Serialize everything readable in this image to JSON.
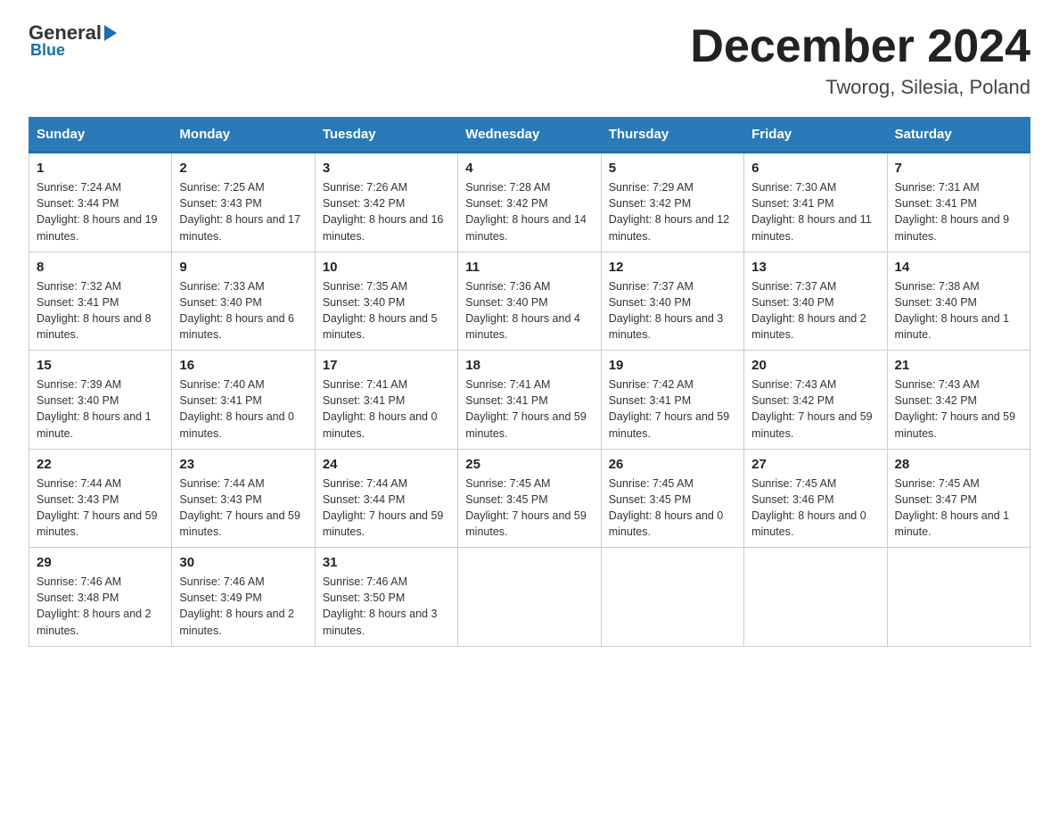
{
  "header": {
    "logo_general": "General",
    "logo_blue": "Blue",
    "month_title": "December 2024",
    "location": "Tworog, Silesia, Poland"
  },
  "days_of_week": [
    "Sunday",
    "Monday",
    "Tuesday",
    "Wednesday",
    "Thursday",
    "Friday",
    "Saturday"
  ],
  "weeks": [
    [
      {
        "day": "1",
        "sunrise": "7:24 AM",
        "sunset": "3:44 PM",
        "daylight": "8 hours and 19 minutes."
      },
      {
        "day": "2",
        "sunrise": "7:25 AM",
        "sunset": "3:43 PM",
        "daylight": "8 hours and 17 minutes."
      },
      {
        "day": "3",
        "sunrise": "7:26 AM",
        "sunset": "3:42 PM",
        "daylight": "8 hours and 16 minutes."
      },
      {
        "day": "4",
        "sunrise": "7:28 AM",
        "sunset": "3:42 PM",
        "daylight": "8 hours and 14 minutes."
      },
      {
        "day": "5",
        "sunrise": "7:29 AM",
        "sunset": "3:42 PM",
        "daylight": "8 hours and 12 minutes."
      },
      {
        "day": "6",
        "sunrise": "7:30 AM",
        "sunset": "3:41 PM",
        "daylight": "8 hours and 11 minutes."
      },
      {
        "day": "7",
        "sunrise": "7:31 AM",
        "sunset": "3:41 PM",
        "daylight": "8 hours and 9 minutes."
      }
    ],
    [
      {
        "day": "8",
        "sunrise": "7:32 AM",
        "sunset": "3:41 PM",
        "daylight": "8 hours and 8 minutes."
      },
      {
        "day": "9",
        "sunrise": "7:33 AM",
        "sunset": "3:40 PM",
        "daylight": "8 hours and 6 minutes."
      },
      {
        "day": "10",
        "sunrise": "7:35 AM",
        "sunset": "3:40 PM",
        "daylight": "8 hours and 5 minutes."
      },
      {
        "day": "11",
        "sunrise": "7:36 AM",
        "sunset": "3:40 PM",
        "daylight": "8 hours and 4 minutes."
      },
      {
        "day": "12",
        "sunrise": "7:37 AM",
        "sunset": "3:40 PM",
        "daylight": "8 hours and 3 minutes."
      },
      {
        "day": "13",
        "sunrise": "7:37 AM",
        "sunset": "3:40 PM",
        "daylight": "8 hours and 2 minutes."
      },
      {
        "day": "14",
        "sunrise": "7:38 AM",
        "sunset": "3:40 PM",
        "daylight": "8 hours and 1 minute."
      }
    ],
    [
      {
        "day": "15",
        "sunrise": "7:39 AM",
        "sunset": "3:40 PM",
        "daylight": "8 hours and 1 minute."
      },
      {
        "day": "16",
        "sunrise": "7:40 AM",
        "sunset": "3:41 PM",
        "daylight": "8 hours and 0 minutes."
      },
      {
        "day": "17",
        "sunrise": "7:41 AM",
        "sunset": "3:41 PM",
        "daylight": "8 hours and 0 minutes."
      },
      {
        "day": "18",
        "sunrise": "7:41 AM",
        "sunset": "3:41 PM",
        "daylight": "7 hours and 59 minutes."
      },
      {
        "day": "19",
        "sunrise": "7:42 AM",
        "sunset": "3:41 PM",
        "daylight": "7 hours and 59 minutes."
      },
      {
        "day": "20",
        "sunrise": "7:43 AM",
        "sunset": "3:42 PM",
        "daylight": "7 hours and 59 minutes."
      },
      {
        "day": "21",
        "sunrise": "7:43 AM",
        "sunset": "3:42 PM",
        "daylight": "7 hours and 59 minutes."
      }
    ],
    [
      {
        "day": "22",
        "sunrise": "7:44 AM",
        "sunset": "3:43 PM",
        "daylight": "7 hours and 59 minutes."
      },
      {
        "day": "23",
        "sunrise": "7:44 AM",
        "sunset": "3:43 PM",
        "daylight": "7 hours and 59 minutes."
      },
      {
        "day": "24",
        "sunrise": "7:44 AM",
        "sunset": "3:44 PM",
        "daylight": "7 hours and 59 minutes."
      },
      {
        "day": "25",
        "sunrise": "7:45 AM",
        "sunset": "3:45 PM",
        "daylight": "7 hours and 59 minutes."
      },
      {
        "day": "26",
        "sunrise": "7:45 AM",
        "sunset": "3:45 PM",
        "daylight": "8 hours and 0 minutes."
      },
      {
        "day": "27",
        "sunrise": "7:45 AM",
        "sunset": "3:46 PM",
        "daylight": "8 hours and 0 minutes."
      },
      {
        "day": "28",
        "sunrise": "7:45 AM",
        "sunset": "3:47 PM",
        "daylight": "8 hours and 1 minute."
      }
    ],
    [
      {
        "day": "29",
        "sunrise": "7:46 AM",
        "sunset": "3:48 PM",
        "daylight": "8 hours and 2 minutes."
      },
      {
        "day": "30",
        "sunrise": "7:46 AM",
        "sunset": "3:49 PM",
        "daylight": "8 hours and 2 minutes."
      },
      {
        "day": "31",
        "sunrise": "7:46 AM",
        "sunset": "3:50 PM",
        "daylight": "8 hours and 3 minutes."
      },
      null,
      null,
      null,
      null
    ]
  ]
}
